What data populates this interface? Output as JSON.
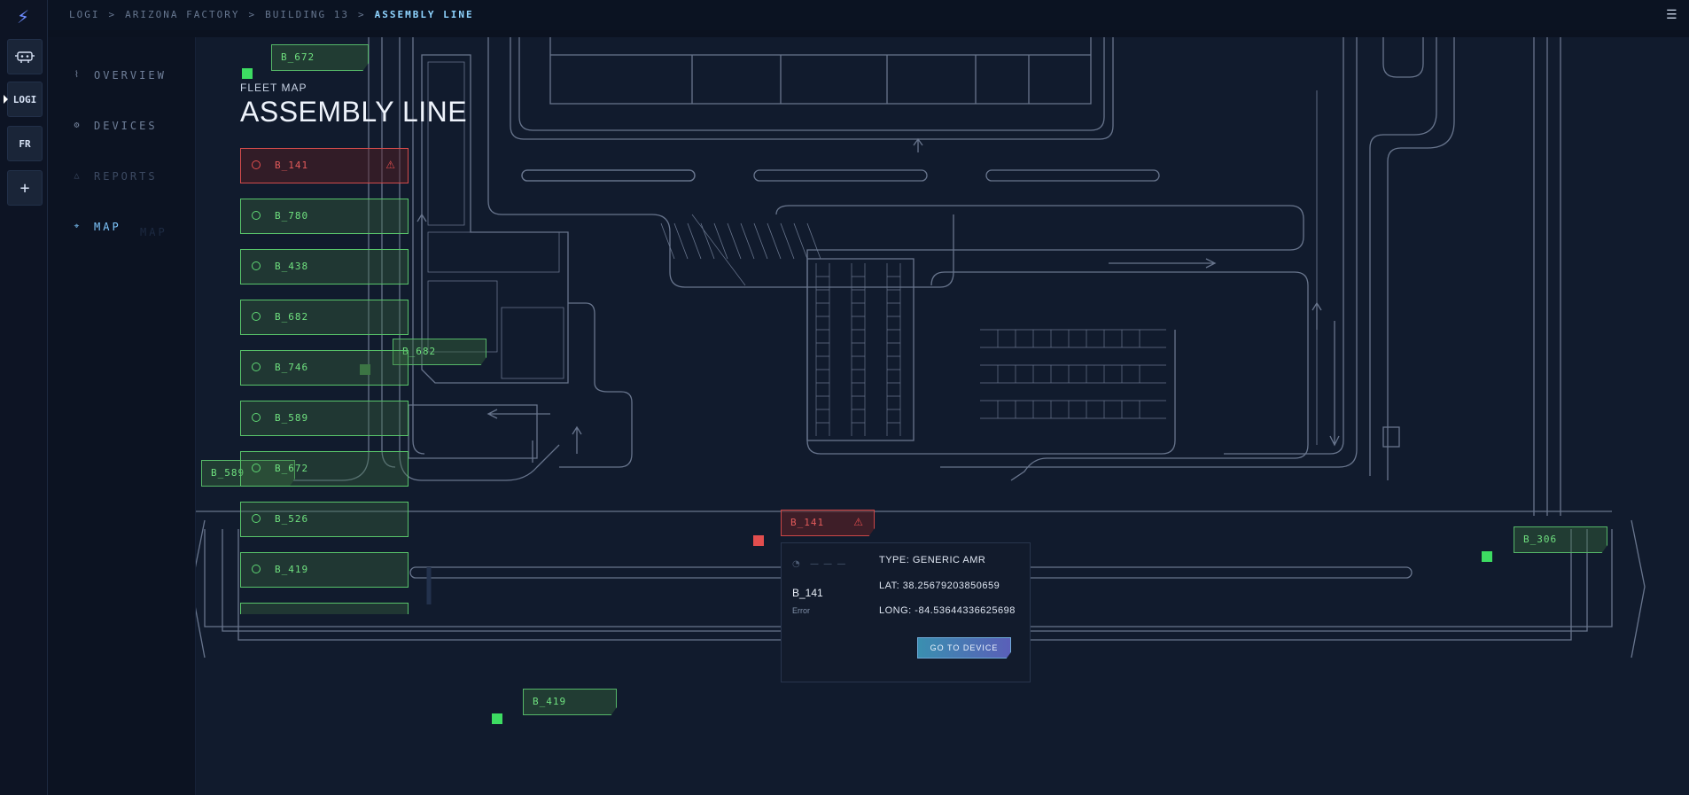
{
  "rail": {
    "logo_icon": "lightning-bolt-icon",
    "buttons": [
      {
        "name": "robot-icon",
        "label": ""
      },
      {
        "name": "logi",
        "label": "LOGI"
      },
      {
        "name": "fr",
        "label": "FR"
      },
      {
        "name": "add",
        "label": "+"
      }
    ]
  },
  "nav": {
    "items": [
      {
        "label": "OVERVIEW",
        "icon": "pulse-icon"
      },
      {
        "label": "DEVICES",
        "icon": "gear-icon"
      },
      {
        "label": "REPORTS",
        "icon": "triangle-icon"
      },
      {
        "label": "MAP",
        "icon": "map-pin-icon"
      }
    ],
    "ghost_label": "MAP"
  },
  "breadcrumb": [
    "LOGI",
    "ARIZONA FACTORY",
    "BUILDING 13",
    "ASSEMBLY LINE"
  ],
  "header": {
    "kicker": "FLEET MAP",
    "title": "ASSEMBLY LINE"
  },
  "device_list": [
    {
      "id": "B_141",
      "status": "error"
    },
    {
      "id": "B_780",
      "status": "ok"
    },
    {
      "id": "B_438",
      "status": "ok"
    },
    {
      "id": "B_682",
      "status": "ok"
    },
    {
      "id": "B_746",
      "status": "ok"
    },
    {
      "id": "B_589",
      "status": "ok"
    },
    {
      "id": "B_672",
      "status": "ok"
    },
    {
      "id": "B_526",
      "status": "ok"
    },
    {
      "id": "B_419",
      "status": "ok"
    }
  ],
  "map_tags": [
    {
      "id": "B_672"
    },
    {
      "id": "B_682"
    },
    {
      "id": "B_589"
    },
    {
      "id": "B_141"
    },
    {
      "id": "B_306"
    },
    {
      "id": "B_419"
    }
  ],
  "popup": {
    "status_text": "— — —",
    "device_name": "B_141",
    "device_state": "Error",
    "type_line": "TYPE: GENERIC AMR",
    "lat_line": "LAT: 38.25679203850659",
    "long_line": "LONG: -84.53644336625698",
    "button_label": "GO TO DEVICE"
  },
  "colors": {
    "ok": "#3ddc62",
    "error": "#e24e4e",
    "accent": "#8fd4ff",
    "background": "#0b1220"
  }
}
